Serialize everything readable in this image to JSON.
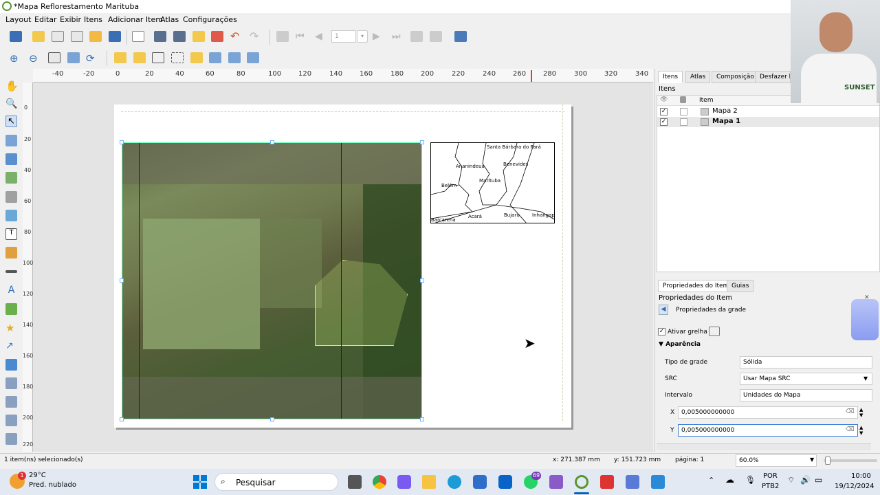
{
  "window": {
    "title": "*Mapa Reflorestamento Marituba"
  },
  "menu": [
    {
      "label": "Layout"
    },
    {
      "label": "Editar"
    },
    {
      "label": "Exibir"
    },
    {
      "label": "Itens"
    },
    {
      "label": "Adicionar Item"
    },
    {
      "label": "Atlas"
    },
    {
      "label": "Configurações"
    }
  ],
  "atlas_page": "1",
  "ruler": {
    "h": [
      "-40",
      "-20",
      "0",
      "20",
      "40",
      "60",
      "80",
      "100",
      "120",
      "140",
      "160",
      "180",
      "200",
      "220",
      "240",
      "260",
      "280",
      "300",
      "320",
      "340"
    ],
    "v": [
      "0",
      "20",
      "40",
      "60",
      "80",
      "100",
      "120",
      "140",
      "160",
      "180",
      "200",
      "220"
    ]
  },
  "inset_map": {
    "labels": [
      "Santa Bárbara do Pará",
      "Ananindeua",
      "Benevides",
      "Marituba",
      "Belém",
      "Barcarena",
      "Acará",
      "Bujaru",
      "Inhangapi"
    ]
  },
  "panel": {
    "tabs": [
      "Itens",
      "Atlas",
      "Composição",
      "Desfazer his"
    ],
    "items_title": "Itens",
    "col_item": "Item",
    "items": [
      {
        "name": "Mapa 2",
        "visible": true,
        "bold": false
      },
      {
        "name": "Mapa 1",
        "visible": true,
        "bold": true
      }
    ],
    "bottom_tabs": [
      "Propriedades do Item",
      "Guias"
    ],
    "props_title": "Propriedades do Item",
    "grid_props_label": "Propriedades da grade",
    "enable_grid": {
      "label": "Ativar grelha",
      "checked": true
    },
    "appearance": "Aparência",
    "rows": [
      {
        "label": "Tipo de grade",
        "value": "Sólida"
      },
      {
        "label": "SRC",
        "value": "Usar Mapa SRC"
      },
      {
        "label": "Intervalo",
        "value": "Unidades do Mapa"
      }
    ],
    "x_label": "X",
    "x_value": "0,005000000000",
    "y_label": "Y",
    "y_value": "0,005000000000"
  },
  "status": {
    "selected": "1 item(ns) selecionado(s)",
    "x": "x: 271.387 mm",
    "y": "y: 151.723 mm",
    "page": "página: 1",
    "zoom": "60.0%"
  },
  "taskbar": {
    "weather_temp": "29°C",
    "weather_desc": "Pred. nublado",
    "search": "Pesquisar",
    "lang1": "POR",
    "lang2": "PTB2",
    "time": "10:00",
    "date": "19/12/2024",
    "whatsapp_badge": "69",
    "weather_badge": "1"
  },
  "webcam": {
    "shirt_text": "SUNSET"
  },
  "colors": {
    "qgis_green": "#589632",
    "selection": "#6fb3ff",
    "accent": "#0067c0"
  }
}
